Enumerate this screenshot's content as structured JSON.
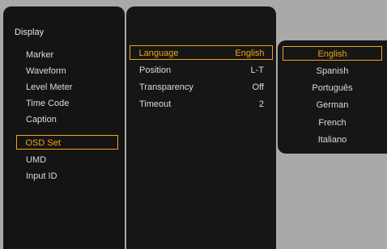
{
  "main_menu": {
    "title": "Display",
    "items": [
      {
        "label": "Marker"
      },
      {
        "label": "Waveform"
      },
      {
        "label": "Level Meter"
      },
      {
        "label": "Time Code"
      },
      {
        "label": "Caption"
      },
      {
        "label": "OSD Set",
        "selected": true
      },
      {
        "label": "UMD"
      },
      {
        "label": "Input ID"
      }
    ]
  },
  "sub_menu": {
    "items": [
      {
        "label": "Language",
        "value": "English",
        "selected": true
      },
      {
        "label": "Position",
        "value": "L-T"
      },
      {
        "label": "Transparency",
        "value": "Off"
      },
      {
        "label": "Timeout",
        "value": "2"
      }
    ]
  },
  "language_options": {
    "items": [
      {
        "label": "English",
        "selected": true
      },
      {
        "label": "Spanish"
      },
      {
        "label": "Português"
      },
      {
        "label": "German"
      },
      {
        "label": "French"
      },
      {
        "label": "Italiano"
      }
    ]
  },
  "colors": {
    "accent": "#f0a31c",
    "panel": "#141414",
    "background": "#a9a9a9",
    "text": "#dcdcdc"
  }
}
